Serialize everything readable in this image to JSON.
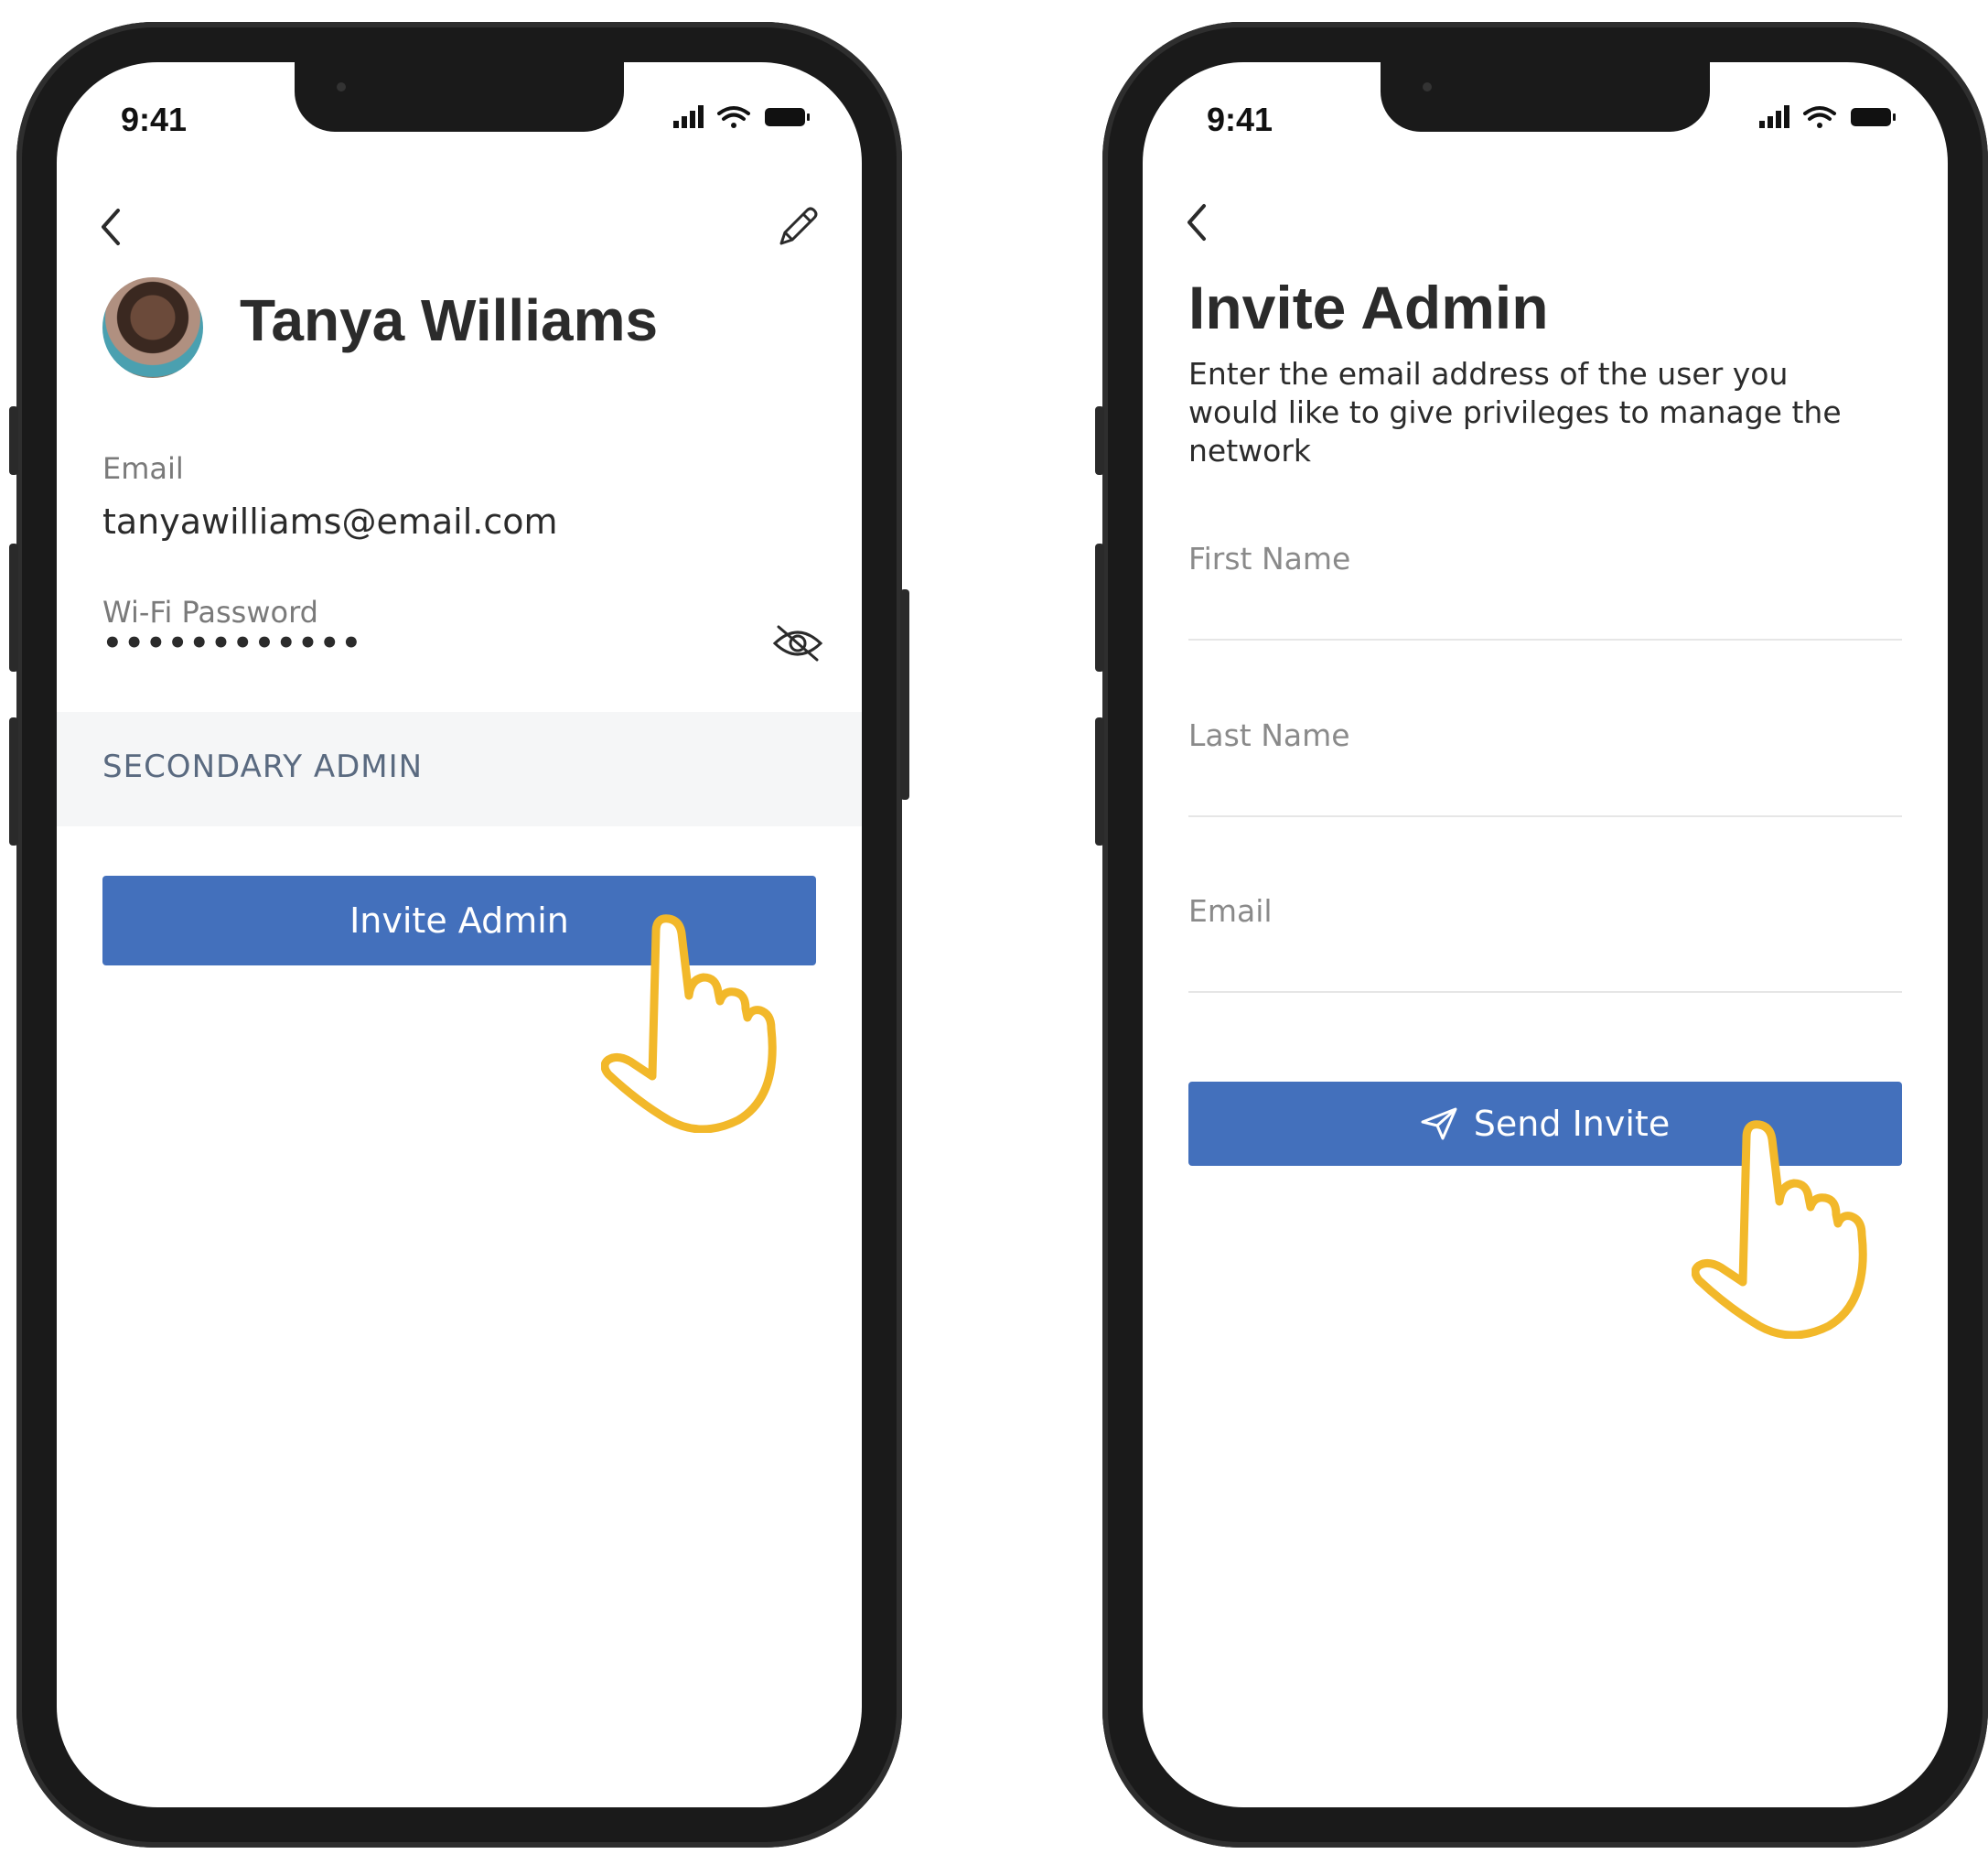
{
  "colors": {
    "accent": "#4370bc",
    "hand": "#f2b82a",
    "section_bg": "#f5f6f7",
    "frame": "#1a1a1a"
  },
  "left_screen": {
    "status_time": "9:41",
    "profile_name": "Tanya Williams",
    "email_label": "Email",
    "email_value": "tanyawilliams@email.com",
    "wifi_password_label": "Wi-Fi Password",
    "wifi_password_value": "••••••••••••",
    "section_title": "SECONDARY ADMIN",
    "invite_button_label": "Invite Admin",
    "icons": [
      "back-chevron-icon",
      "edit-pencil-icon",
      "eye-off-icon",
      "tap-hand-icon"
    ]
  },
  "right_screen": {
    "status_time": "9:41",
    "title": "Invite Admin",
    "description": "Enter the email address of the user you would like to give privileges to manage the network",
    "fields": [
      {
        "label": "First Name",
        "value": ""
      },
      {
        "label": "Last Name",
        "value": ""
      },
      {
        "label": "Email",
        "value": ""
      }
    ],
    "send_button_label": "Send Invite",
    "icons": [
      "back-chevron-icon",
      "send-plane-icon",
      "tap-hand-icon"
    ]
  }
}
